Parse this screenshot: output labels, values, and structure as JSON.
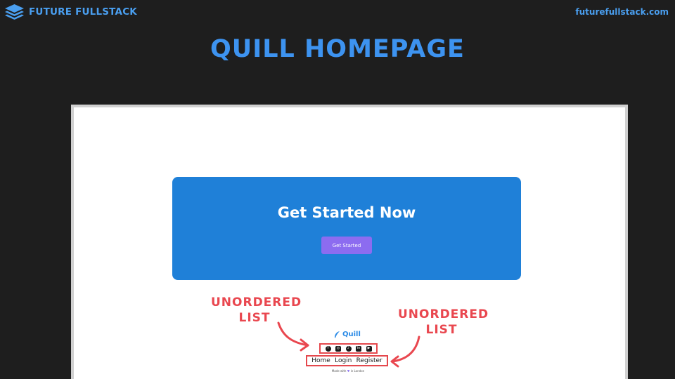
{
  "header": {
    "brand_name": "FUTURE FULLSTACK",
    "site_url": "futurefullstack.com",
    "brand_icon": "stacked-layers-icon"
  },
  "slide": {
    "title": "QUILL HOMEPAGE"
  },
  "page": {
    "hero_title": "Get Started Now",
    "hero_button": "Get Started",
    "logo_text": "Quill",
    "logo_icon": "feather-icon",
    "social_icons": [
      "facebook-icon",
      "instagram-icon",
      "tiktok-icon",
      "linkedin-icon",
      "youtube-icon"
    ],
    "nav_links": [
      "Home",
      "Login",
      "Register"
    ],
    "footer_made_with": "Made with",
    "footer_in_london": "in London"
  },
  "annotations": {
    "left_line1": "UNORDERED",
    "left_line2": "LIST",
    "right_line1": "UNORDERED",
    "right_line2": "LIST"
  },
  "colors": {
    "background": "#1e1e1e",
    "brand_blue": "#4a9ff0",
    "hero_blue": "#1f80d8",
    "button_purple": "#8c6cf0",
    "annotation_red": "#e9474f"
  }
}
